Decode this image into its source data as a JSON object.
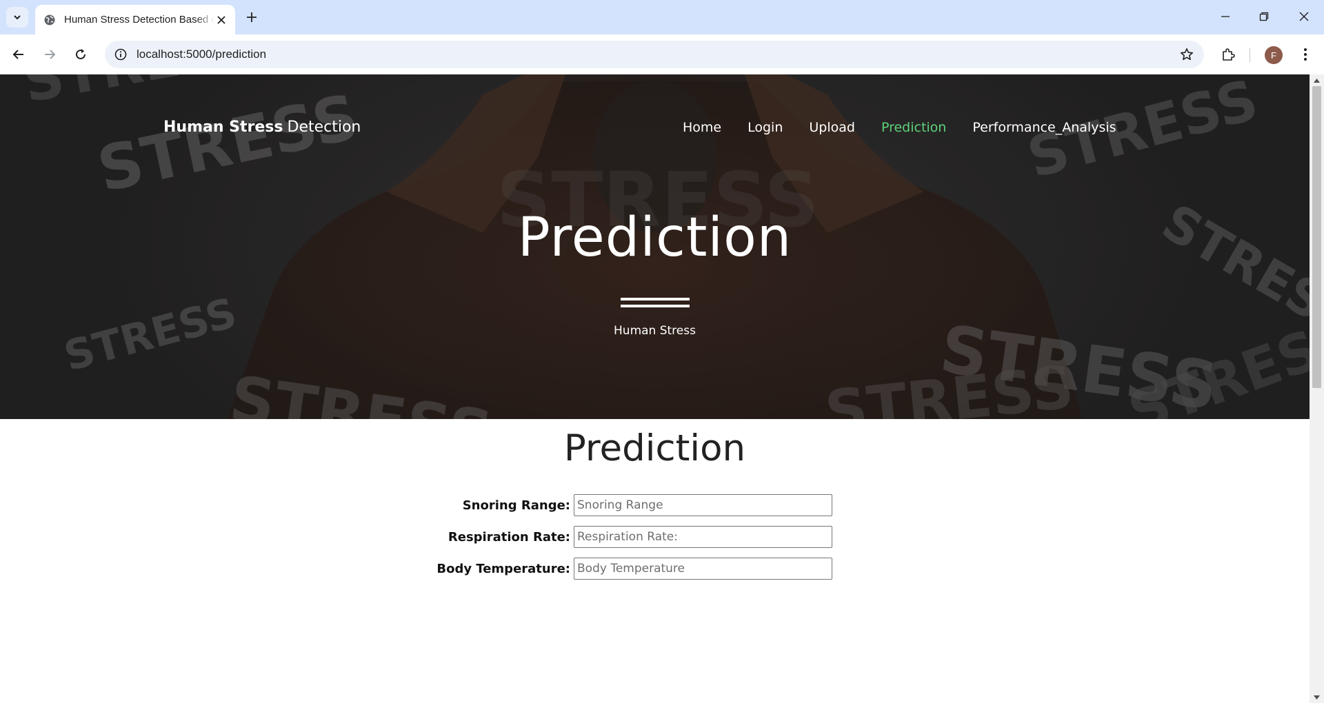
{
  "browser": {
    "tab_title": "Human Stress Detection Based on Sleeping Habits",
    "url": "localhost:5000/prediction",
    "profile_initial": "F"
  },
  "site": {
    "brand_strong": "Human Stress",
    "brand_light": "Detection",
    "nav": [
      "Home",
      "Login",
      "Upload",
      "Prediction",
      "Performance_Analysis"
    ],
    "active_nav": "Prediction",
    "active_color": "#5ed37a"
  },
  "hero": {
    "title": "Prediction",
    "subtitle": "Human Stress",
    "background_word": "STRESS"
  },
  "main": {
    "title": "Prediction",
    "accent_color": "#3b7bd6",
    "fields": [
      {
        "label": "Snoring Range:",
        "placeholder": "Snoring Range"
      },
      {
        "label": "Respiration Rate:",
        "placeholder": "Respiration Rate:"
      },
      {
        "label": "Body Temperature:",
        "placeholder": "Body Temperature"
      }
    ]
  }
}
